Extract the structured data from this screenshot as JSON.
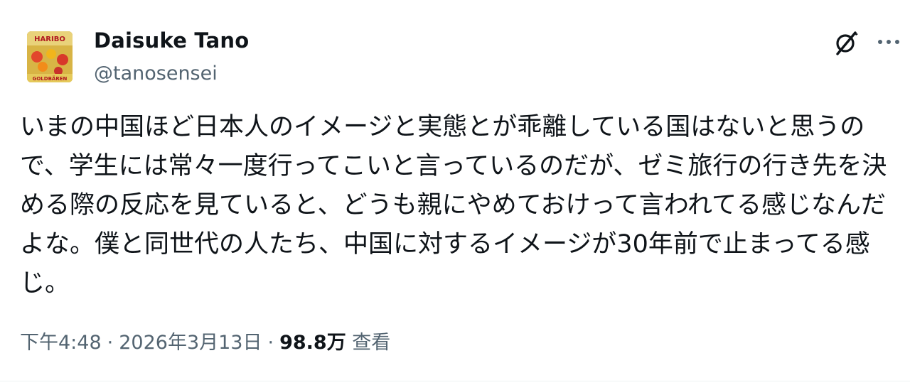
{
  "tweet": {
    "author": {
      "display_name": "Daisuke Tano",
      "handle": "@tanosensei",
      "avatar_text_top": "HARIBO",
      "avatar_text_bottom": "GOLDBÄREN"
    },
    "header_icons": [
      "grok-icon",
      "more-options-icon"
    ],
    "text": "いまの中国ほど日本人のイメージと実態とが乖離している国はないと思うので、学生には常々一度行ってこいと言っているのだが、ゼミ旅行の行き先を決める際の反応を見ていると、どうも親にやめておけって言われてる感じなんだよな。僕と同世代の人たち、中国に対するイメージが30年前で止まってる感じ。",
    "meta": {
      "time": "下午4:48",
      "date": "2026年3月13日",
      "separator": "·",
      "views_count": "98.8万",
      "views_label": "查看"
    }
  }
}
